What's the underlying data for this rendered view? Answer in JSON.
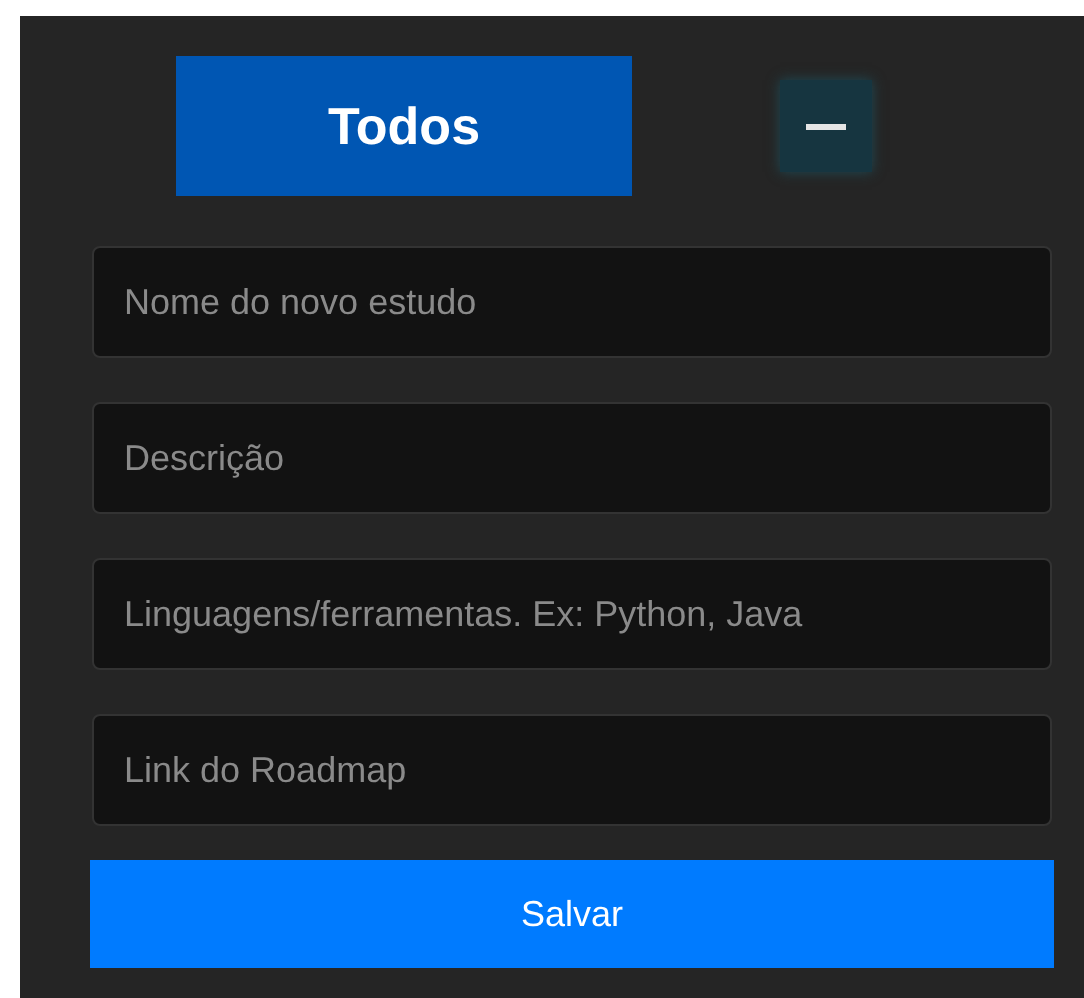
{
  "filter_button": {
    "label": "Todos"
  },
  "fields": [
    {
      "placeholder": "Nome do novo estudo"
    },
    {
      "placeholder": "Descrição"
    },
    {
      "placeholder": "Linguagens/ferramentas. Ex: Python, Java"
    },
    {
      "placeholder": "Link do Roadmap"
    }
  ],
  "save_button": {
    "label": "Salvar"
  }
}
